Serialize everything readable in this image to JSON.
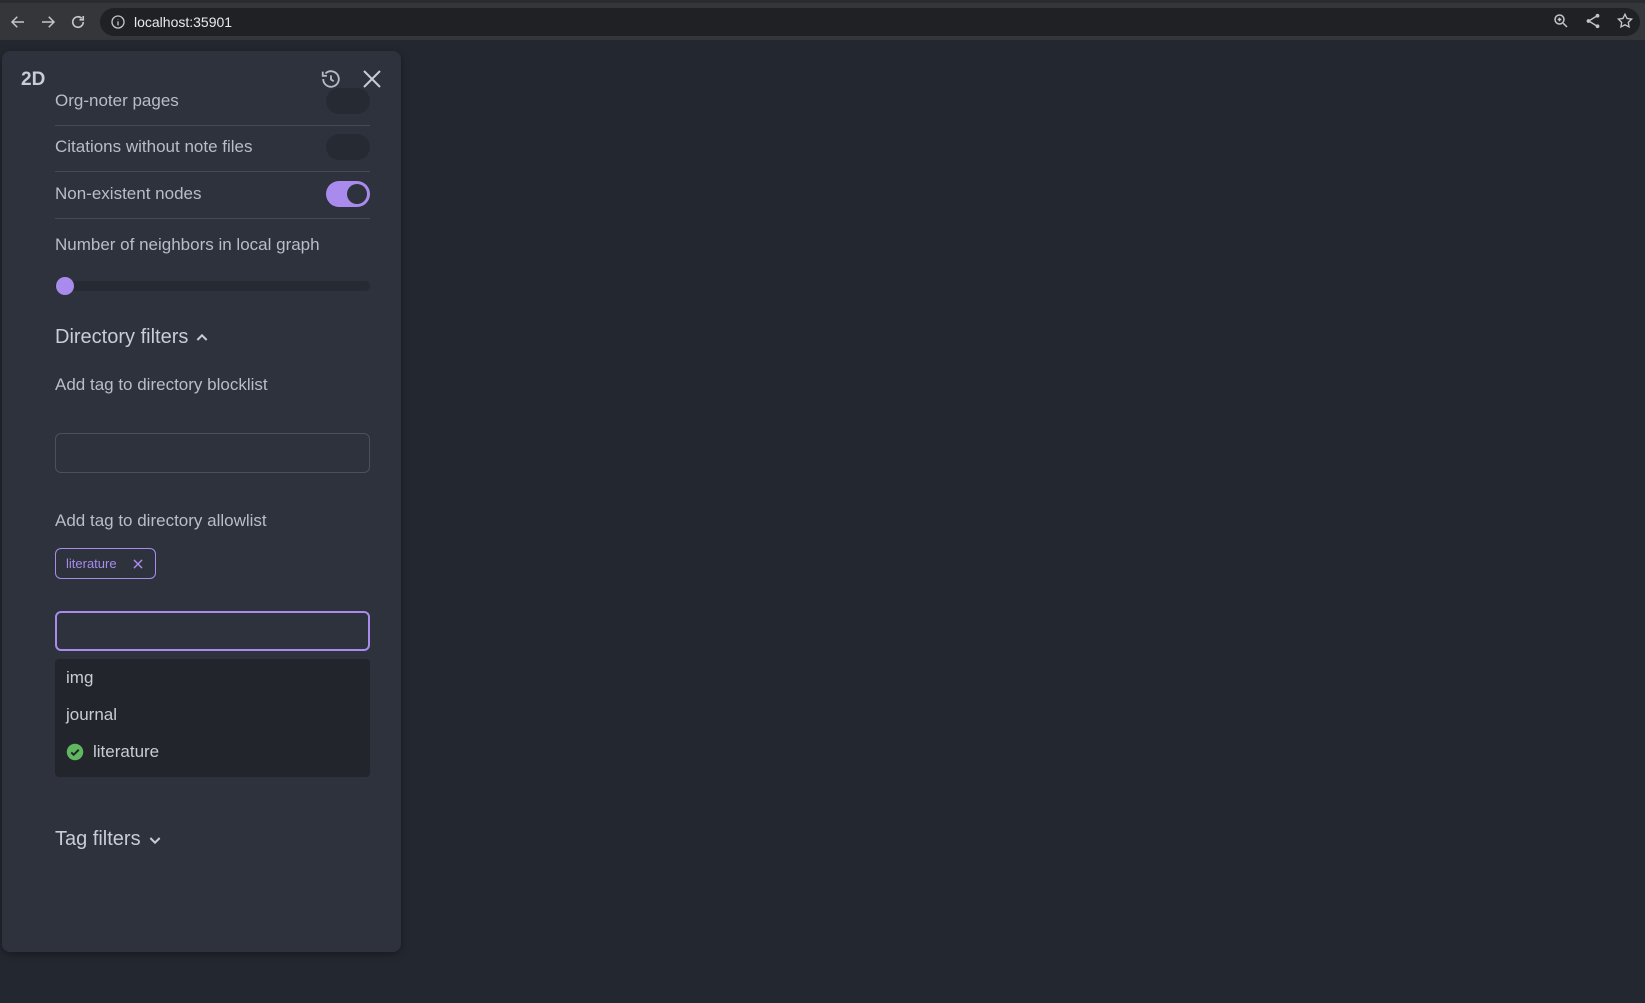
{
  "browser": {
    "url": "localhost:35901"
  },
  "panel": {
    "title": "2D",
    "toggles": [
      {
        "label": "Org-noter pages",
        "on": false
      },
      {
        "label": "Citations without note files",
        "on": false
      },
      {
        "label": "Non-existent nodes",
        "on": true
      }
    ],
    "neighbors_label": "Number of neighbors in local graph",
    "neighbors_value": 0,
    "directory_filters": {
      "heading": "Directory filters",
      "blocklist_label": "Add tag to directory blocklist",
      "blocklist_value": "",
      "allowlist_label": "Add tag to directory allowlist",
      "allowlist_tags": [
        "literature"
      ],
      "allowlist_input_value": "",
      "options": [
        {
          "label": "img",
          "selected": false
        },
        {
          "label": "journal",
          "selected": false
        },
        {
          "label": "literature",
          "selected": true
        }
      ]
    },
    "tag_filters": {
      "heading": "Tag filters"
    }
  },
  "colors": {
    "accent": "#a88bec",
    "background": "#23272f",
    "panel": "#2d323c",
    "check": "#5fb85f"
  }
}
